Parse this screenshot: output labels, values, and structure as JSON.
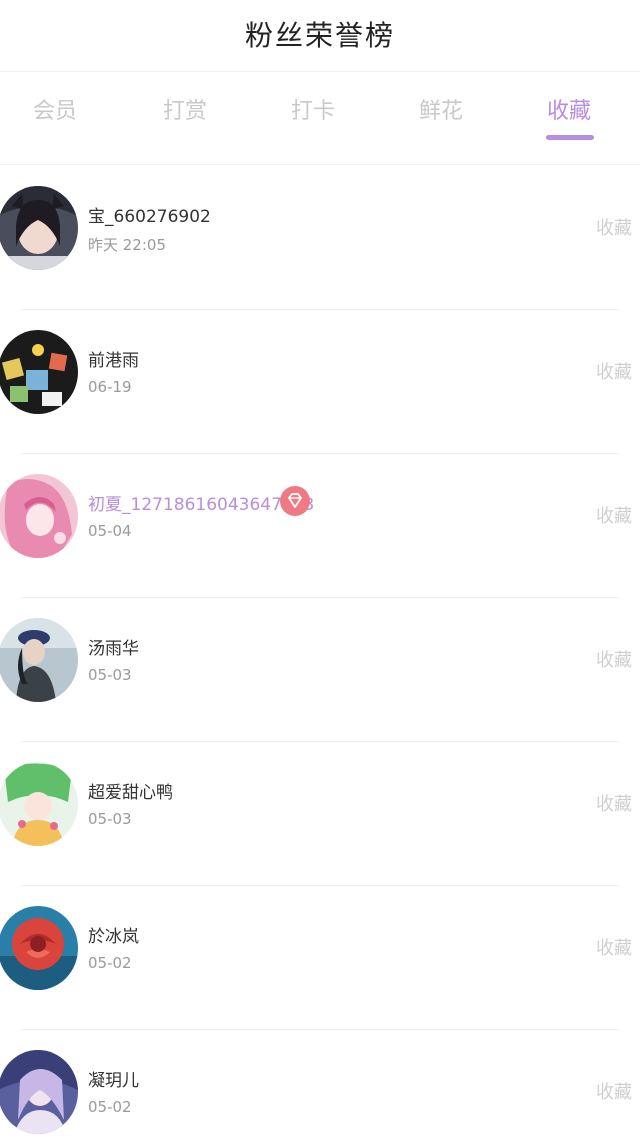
{
  "header": {
    "title": "粉丝荣誉榜"
  },
  "tabs": [
    {
      "label": "会员"
    },
    {
      "label": "打赏"
    },
    {
      "label": "打卡"
    },
    {
      "label": "鲜花"
    },
    {
      "label": "收藏"
    }
  ],
  "active_tab": "收藏",
  "colors": {
    "accent": "#b98ee0",
    "badge": "#f07a84"
  },
  "rows": [
    {
      "name": "宝_660276902",
      "date": "昨天 22:05",
      "action": "收藏"
    },
    {
      "name": "前港雨",
      "date": "06-19",
      "action": "收藏"
    },
    {
      "name": "初夏_12718616043647713",
      "date": "05-04",
      "action": "收藏",
      "vip": true
    },
    {
      "name": "汤雨华",
      "date": "05-03",
      "action": "收藏"
    },
    {
      "name": "超爱甜心鸭",
      "date": "05-03",
      "action": "收藏"
    },
    {
      "name": "於冰岚",
      "date": "05-02",
      "action": "收藏"
    },
    {
      "name": "凝玥儿",
      "date": "05-02",
      "action": "收藏"
    }
  ]
}
